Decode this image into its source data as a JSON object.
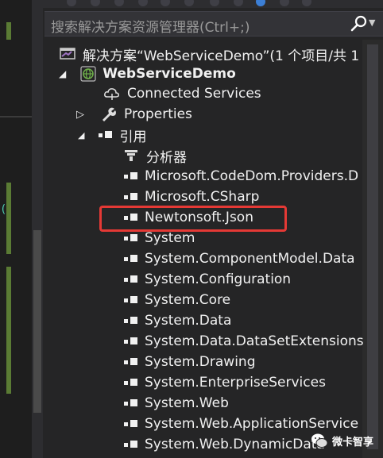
{
  "search": {
    "placeholder": "搜索解决方案资源管理器(Ctrl+;)"
  },
  "tree": {
    "solution": "解决方案“WebServiceDemo”(1 个项目/共 1",
    "project": "WebServiceDemo",
    "connected_services": "Connected Services",
    "properties": "Properties",
    "references": "引用",
    "analyzers": "分析器",
    "refs": [
      "Microsoft.CodeDom.Providers.D",
      "Microsoft.CSharp",
      "Newtonsoft.Json",
      "System",
      "System.ComponentModel.Data",
      "System.Configuration",
      "System.Core",
      "System.Data",
      "System.Data.DataSetExtensions",
      "System.Drawing",
      "System.EnterpriseServices",
      "System.Web",
      "System.Web.ApplicationService",
      "System.Web.DynamicData"
    ]
  },
  "highlighted_ref": "Newtonsoft.Json",
  "watermark": "微卡智享",
  "icons": {
    "search": "search-icon",
    "solution": "solution-icon",
    "project": "web-project-icon",
    "connected": "cloud-connected-icon",
    "properties": "wrench-icon",
    "reference": "reference-icon",
    "analyzer": "analyzer-icon"
  },
  "colors": {
    "highlight": "#e53935",
    "background": "#252526",
    "text": "#f1f1f1"
  }
}
